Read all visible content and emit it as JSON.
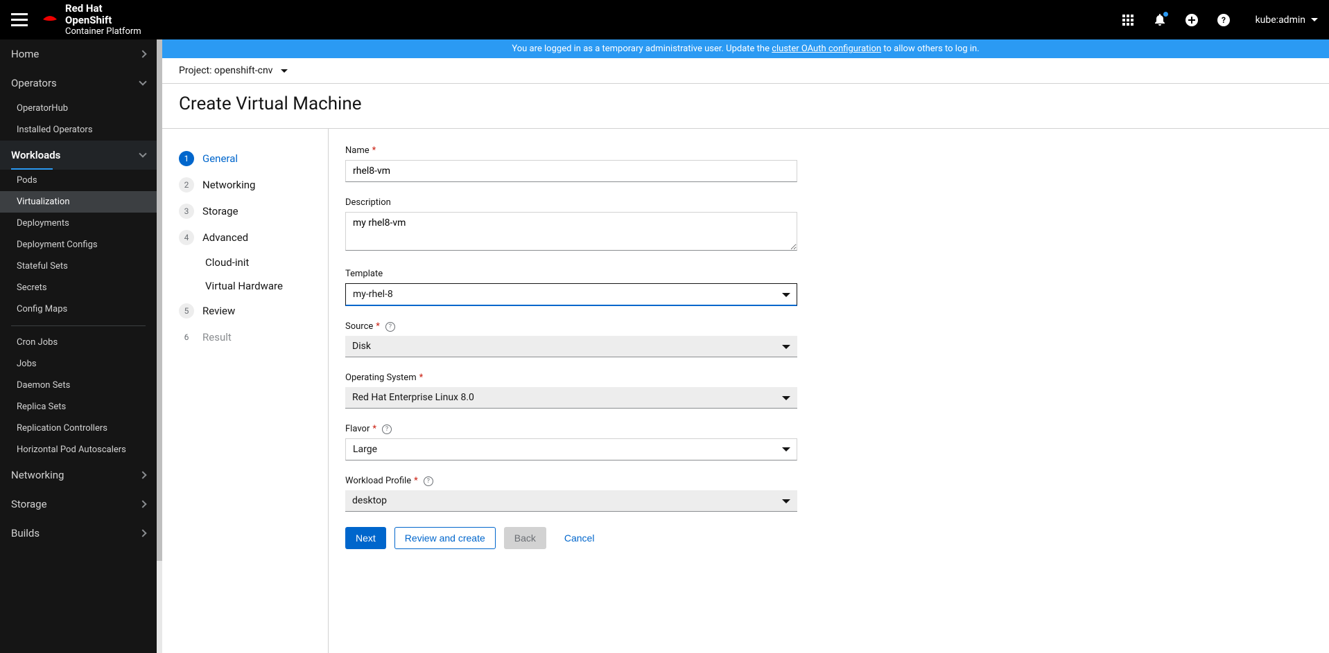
{
  "brand": {
    "line1": "Red Hat",
    "line2": "OpenShift",
    "line3": "Container Platform"
  },
  "user": "kube:admin",
  "banner": {
    "prefix": "You are logged in as a temporary administrative user. Update the ",
    "link": "cluster OAuth configuration",
    "suffix": " to allow others to log in."
  },
  "project": {
    "label": "Project: openshift-cnv"
  },
  "page_title": "Create Virtual Machine",
  "sidebar": {
    "home": "Home",
    "operators": "Operators",
    "operatorhub": "OperatorHub",
    "installed_operators": "Installed Operators",
    "workloads": "Workloads",
    "pods": "Pods",
    "virtualization": "Virtualization",
    "deployments": "Deployments",
    "deployment_configs": "Deployment Configs",
    "stateful_sets": "Stateful Sets",
    "secrets": "Secrets",
    "config_maps": "Config Maps",
    "cron_jobs": "Cron Jobs",
    "jobs": "Jobs",
    "daemon_sets": "Daemon Sets",
    "replica_sets": "Replica Sets",
    "replication_controllers": "Replication Controllers",
    "hpa": "Horizontal Pod Autoscalers",
    "networking": "Networking",
    "storage": "Storage",
    "builds": "Builds"
  },
  "wizard": {
    "s1": "General",
    "s2": "Networking",
    "s3": "Storage",
    "s4": "Advanced",
    "s4a": "Cloud-init",
    "s4b": "Virtual Hardware",
    "s5": "Review",
    "s6": "Result"
  },
  "form": {
    "name_label": "Name",
    "name_value": "rhel8-vm",
    "desc_label": "Description",
    "desc_value": "my rhel8-vm",
    "template_label": "Template",
    "template_value": "my-rhel-8",
    "source_label": "Source",
    "source_value": "Disk",
    "os_label": "Operating System",
    "os_value": "Red Hat Enterprise Linux 8.0",
    "flavor_label": "Flavor",
    "flavor_value": "Large",
    "workload_label": "Workload Profile",
    "workload_value": "desktop"
  },
  "buttons": {
    "next": "Next",
    "review_create": "Review and create",
    "back": "Back",
    "cancel": "Cancel"
  }
}
